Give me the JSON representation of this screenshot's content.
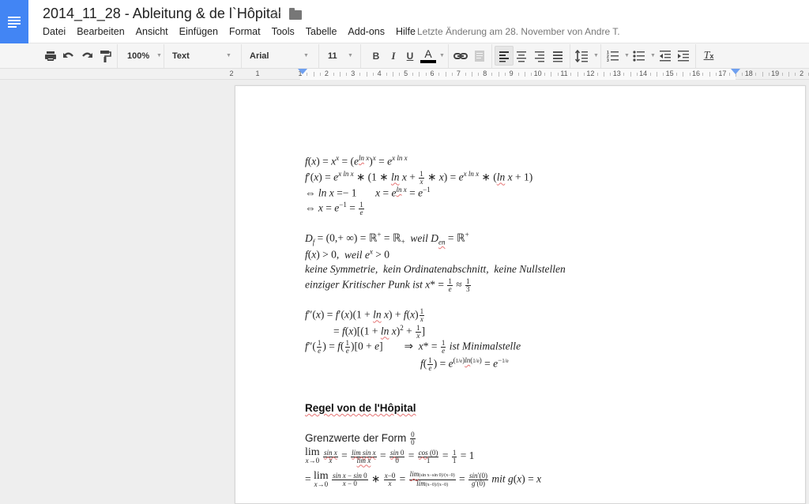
{
  "app": {
    "doc_title": "2014_11_28 - Ableitung & de l`Hôpital",
    "last_edit": "Letzte Änderung am 28. November von Andre T."
  },
  "menu": [
    "Datei",
    "Bearbeiten",
    "Ansicht",
    "Einfügen",
    "Format",
    "Tools",
    "Tabelle",
    "Add-ons",
    "Hilfe"
  ],
  "toolbar": {
    "zoom": "100%",
    "style": "Text",
    "font": "Arial",
    "size": "11",
    "bold": "B",
    "italic": "I",
    "underline": "U",
    "text_color": "A",
    "text_color_value": "#000000",
    "clear_format": "Tx"
  },
  "ruler": {
    "left_labels": [
      "2",
      "1"
    ],
    "labels": [
      "1",
      "2",
      "3",
      "4",
      "5",
      "6",
      "7",
      "8",
      "9",
      "10",
      "11",
      "12",
      "13",
      "14",
      "15",
      "16",
      "17",
      "18",
      "19",
      "2"
    ]
  },
  "document": {
    "block1": [
      "f(x) = xˣ = (e^(ln x))ˣ = e^(x ln x)",
      "f′(x) = e^(x ln x) ∗ (1 ∗ ln x + 1/x ∗ x) = e^(x ln x) ∗ (ln x + 1)",
      "⇔ ln x = − 1      x = e^(ln x) = e^(−1)",
      "⇔ x = e^(−1) = 1/e"
    ],
    "block2": [
      "D_f = (0,+ ∞) = ℝ⁺ = ℝ₊  weil D_en = ℝ⁺",
      "f(x) > 0,  weil eˣ > 0",
      "keine Symmetrie,  kein Ordinatenabschnitt,  keine Nullstellen",
      "einziger Kritischer Punk ist x* = 1/e ≈ 1/3"
    ],
    "block3": [
      "f″(x) = f′(x)(1 + ln x) + f(x)1/x",
      "= f(x)[(1 + ln x)² + 1/x]",
      "f″(1/e) = f(1/e)[0 + e]       ⇒  x* = 1/e ist Minimalstelle",
      "f(1/e) = e^((1/e)ln(1/e)) = e^(−1/e)"
    ],
    "heading": "Regel von de l'Hôpital",
    "grenz_label": "Grenzwerte der Form",
    "grenz_frac": [
      "0",
      "0"
    ],
    "lim_line1": "lim_{x→0} sin x / x = lim sin x / lim x = sin 0 / 0 = cos (0) / 1 = 1/1 = 1",
    "lim_line2": "= lim_{x→0} (sin x − sin 0)/(x − 0) ∗ (x−0)/x = ... = sin′(0)/g′(0) mit g(x) = x"
  }
}
